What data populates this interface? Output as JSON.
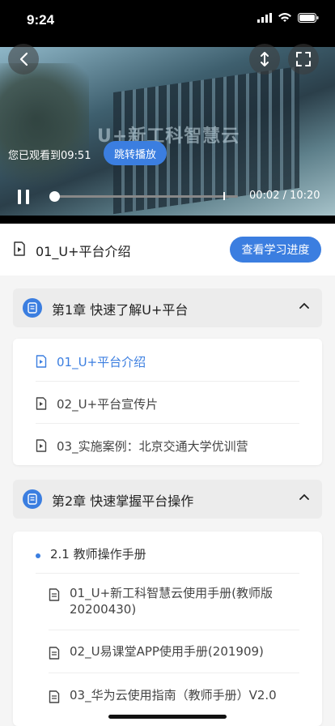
{
  "status": {
    "time": "9:24"
  },
  "player": {
    "watermark": "U+新工科智慧云",
    "resume_text": "您已观看到09:51",
    "resume_button": "跳转播放",
    "time": "00:02 / 10:20",
    "progress_fraction": 0.003
  },
  "header": {
    "title": "01_U+平台介绍",
    "progress_button": "查看学习进度"
  },
  "chapters": [
    {
      "label": "第1章  快速了解U+平台",
      "items": [
        {
          "label": "01_U+平台介绍",
          "active": true
        },
        {
          "label": "02_U+平台宣传片",
          "active": false
        },
        {
          "label": "03_实施案例：北京交通大学优训营",
          "active": false
        }
      ]
    },
    {
      "label": "第2章  快速掌握平台操作",
      "section": "2.1 教师操作手册",
      "docs": [
        {
          "line1": "01_U+新工科智慧云使用手册(教师版",
          "line2": "20200430)"
        },
        {
          "line1": "02_U易课堂APP使用手册(201909)"
        },
        {
          "line1": "03_华为云使用指南（教师手册）V2.0"
        }
      ]
    }
  ],
  "colors": {
    "accent": "#3b7ee0"
  }
}
